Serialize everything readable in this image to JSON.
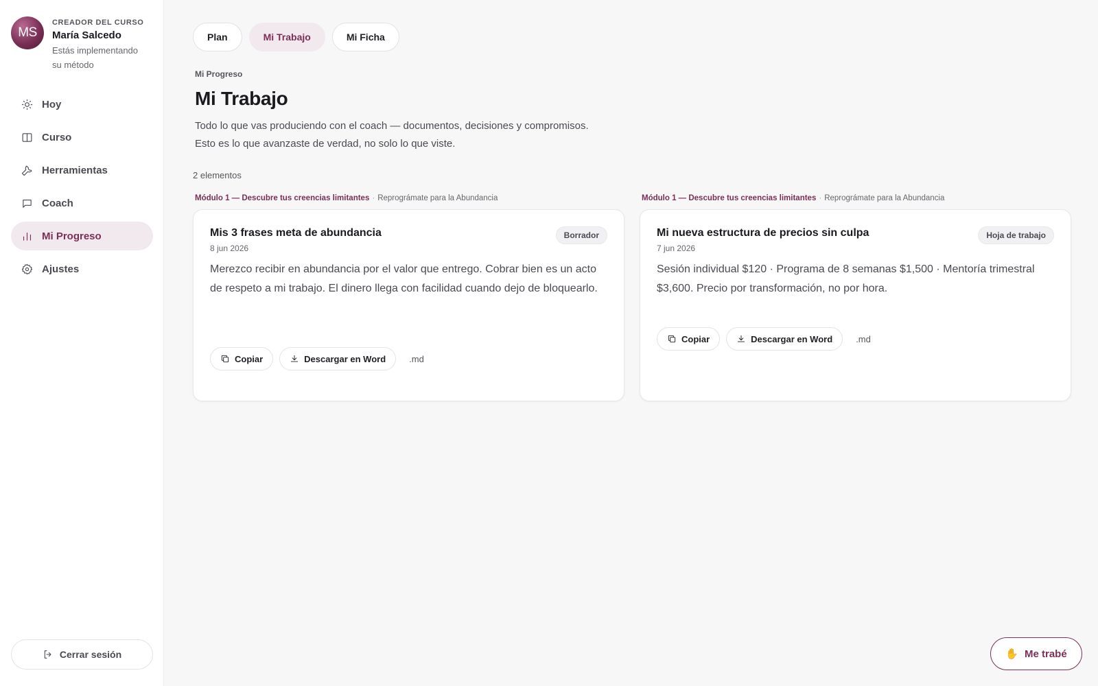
{
  "profile": {
    "initials": "MS",
    "role": "CREADOR DEL CURSO",
    "name": "María Salcedo",
    "subtitle": "Estás implementando su método"
  },
  "sidebar": {
    "items": [
      {
        "label": "Hoy",
        "icon": "sun-icon",
        "active": false
      },
      {
        "label": "Curso",
        "icon": "book-icon",
        "active": false
      },
      {
        "label": "Herramientas",
        "icon": "wrench-icon",
        "active": false
      },
      {
        "label": "Coach",
        "icon": "chat-icon",
        "active": false
      },
      {
        "label": "Mi Progreso",
        "icon": "bar-chart-icon",
        "active": true
      },
      {
        "label": "Ajustes",
        "icon": "gear-icon",
        "active": false
      }
    ],
    "logout_label": "Cerrar sesión"
  },
  "tabs": [
    {
      "label": "Plan",
      "active": false
    },
    {
      "label": "Mi Trabajo",
      "active": true
    },
    {
      "label": "Mi Ficha",
      "active": false
    }
  ],
  "page": {
    "eyebrow": "Mi Progreso",
    "title": "Mi Trabajo",
    "description_line1": "Todo lo que vas produciendo con el coach — documentos, decisiones y compromisos.",
    "description_line2": "Esto es lo que avanzaste de verdad, no solo lo que viste.",
    "count": "2 elementos"
  },
  "cards": [
    {
      "module": "Módulo 1 — Descubre tus creencias limitantes",
      "separator": "·",
      "course": "Reprográmate para la Abundancia",
      "title": "Mis 3 frases meta de abundancia",
      "date": "8 jun 2026",
      "badge": "Borrador",
      "body": "Merezco recibir en abundancia por el valor que entrego. Cobrar bien es un acto de respeto a mi trabajo. El dinero llega con facilidad cuando dejo de bloquearlo.",
      "copy_label": "Copiar",
      "word_label": "Descargar en Word",
      "md_label": ".md"
    },
    {
      "module": "Módulo 1 — Descubre tus creencias limitantes",
      "separator": "·",
      "course": "Reprográmate para la Abundancia",
      "title": "Mi nueva estructura de precios sin culpa",
      "date": "7 jun 2026",
      "badge": "Hoja de trabajo",
      "body": "Sesión individual $120 · Programa de 8 semanas $1,500 · Mentoría trimestral $3,600. Precio por transformación, no por hora.",
      "copy_label": "Copiar",
      "word_label": "Descargar en Word",
      "md_label": ".md"
    }
  ],
  "help_button": {
    "icon": "hand-icon",
    "label": "Me trabé"
  },
  "colors": {
    "accent": "#7b2f58",
    "accent_bg": "#f2e9ee",
    "background": "#f7f7f8"
  }
}
